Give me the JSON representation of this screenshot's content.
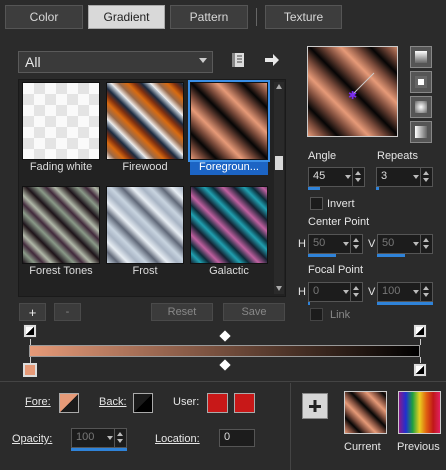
{
  "tabs": [
    {
      "label": "Color"
    },
    {
      "label": "Gradient"
    },
    {
      "label": "Pattern"
    },
    {
      "label": "Texture"
    }
  ],
  "category_dropdown": {
    "value": "All"
  },
  "gradients": [
    {
      "name": "Fading white"
    },
    {
      "name": "Firewood"
    },
    {
      "name": "Foregroun..."
    },
    {
      "name": "Forest Tones"
    },
    {
      "name": "Frost"
    },
    {
      "name": "Galactic"
    }
  ],
  "buttons": {
    "add": "+",
    "remove": "-",
    "reset": "Reset",
    "save": "Save"
  },
  "angle": {
    "label": "Angle",
    "value": "45"
  },
  "repeats": {
    "label": "Repeats",
    "value": "3"
  },
  "invert": {
    "label": "Invert"
  },
  "center_point": {
    "label": "Center Point",
    "h_label": "H",
    "h_value": "50",
    "v_label": "V",
    "v_value": "50"
  },
  "focal_point": {
    "label": "Focal Point",
    "h_label": "H",
    "h_value": "0",
    "v_label": "V",
    "v_value": "100"
  },
  "link": {
    "label": "Link"
  },
  "fore_label": "Fore:",
  "back_label": "Back:",
  "user_label": "User:",
  "opacity": {
    "label": "Opacity:",
    "value": "100"
  },
  "location": {
    "label": "Location:",
    "value": "0"
  },
  "current_label": "Current",
  "previous_label": "Previous",
  "colors": {
    "accent": "#1c64c4",
    "foreground": "#e69a78",
    "background": "#000000",
    "user_1": "#c81818",
    "user_2": "#c81818"
  }
}
